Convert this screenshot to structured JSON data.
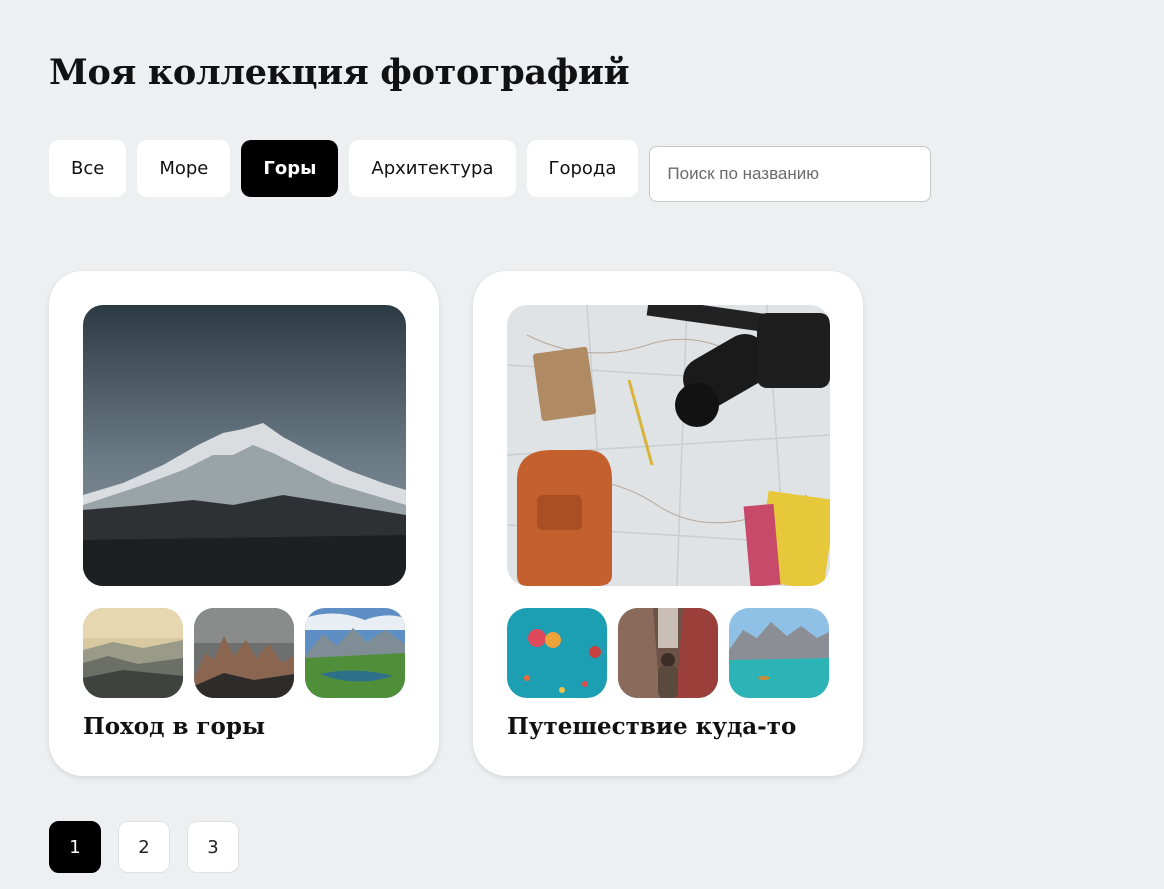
{
  "page": {
    "title": "Моя коллекция фотографий"
  },
  "filters": {
    "tabs": [
      {
        "label": "Все",
        "active": false
      },
      {
        "label": "Море",
        "active": false
      },
      {
        "label": "Горы",
        "active": true
      },
      {
        "label": "Архитектура",
        "active": false
      },
      {
        "label": "Города",
        "active": false
      }
    ],
    "search": {
      "placeholder": "Поиск по названию",
      "value": ""
    }
  },
  "collections": [
    {
      "title": "Поход в горы",
      "main_photo": "snowy-mountain-peak",
      "thumbs": [
        "misty-hills",
        "rocky-peaks",
        "mountain-lake"
      ]
    },
    {
      "title": "Путешествие куда-то",
      "main_photo": "map-camera-flatlay",
      "thumbs": [
        "hot-air-balloons",
        "narrow-street",
        "turquoise-lake"
      ]
    }
  ],
  "pagination": {
    "pages": [
      "1",
      "2",
      "3"
    ],
    "current": "1"
  },
  "colors": {
    "background": "#eeeff1",
    "active": "#000000",
    "card": "#ffffff"
  }
}
